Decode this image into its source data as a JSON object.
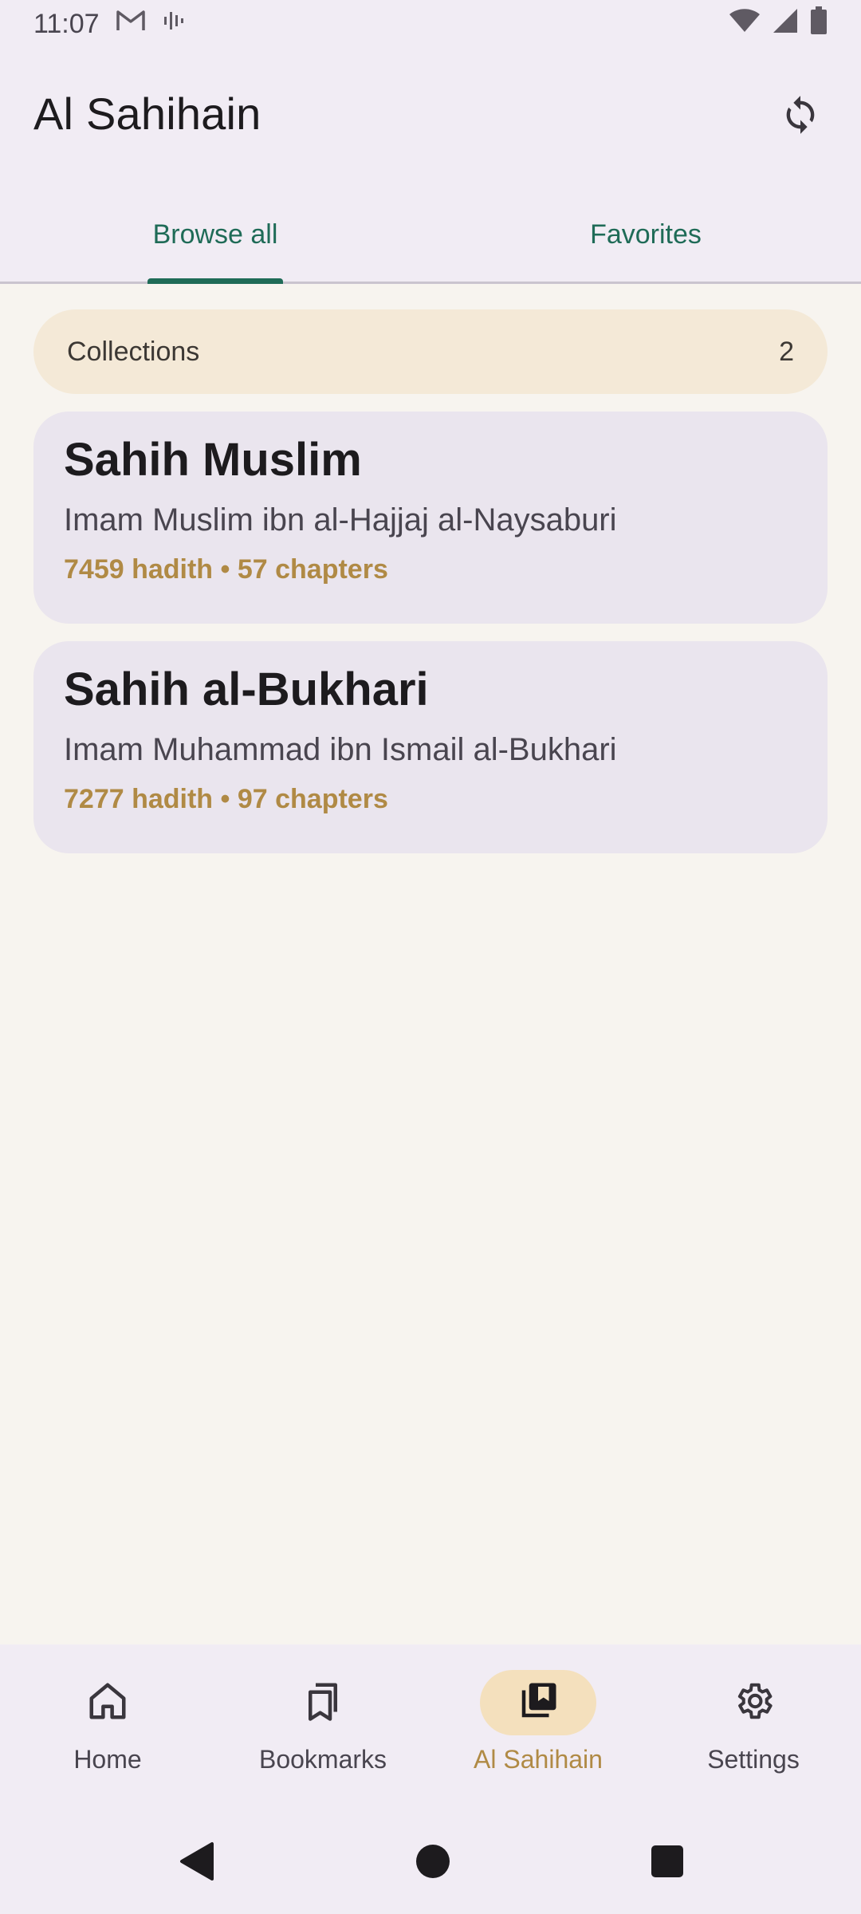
{
  "status_bar": {
    "time": "11:07",
    "icons": [
      "gmail-icon",
      "audio-icon",
      "wifi-icon",
      "signal-icon",
      "battery-icon"
    ]
  },
  "app_bar": {
    "title": "Al Sahihain",
    "action_icon": "refresh-icon"
  },
  "tabs": [
    {
      "label": "Browse all",
      "selected": true
    },
    {
      "label": "Favorites",
      "selected": false
    }
  ],
  "collections": {
    "label": "Collections",
    "count": "2"
  },
  "cards": [
    {
      "title": "Sahih Muslim",
      "author": "Imam Muslim ibn al-Hajjaj al-Naysaburi",
      "meta": "7459 hadith • 57 chapters"
    },
    {
      "title": "Sahih al-Bukhari",
      "author": "Imam Muhammad ibn Ismail al-Bukhari",
      "meta": "7277 hadith • 97 chapters"
    }
  ],
  "bottom_nav": [
    {
      "label": "Home",
      "icon": "home-icon",
      "active": false
    },
    {
      "label": "Bookmarks",
      "icon": "bookmarks-icon",
      "active": false
    },
    {
      "label": "Al Sahihain",
      "icon": "library-icon",
      "active": true
    },
    {
      "label": "Settings",
      "icon": "gear-icon",
      "active": false
    }
  ],
  "colors": {
    "accent_green": "#1f6b57",
    "accent_gold": "#b08a45",
    "surface": "#f1ecf4",
    "card": "#eae5ee",
    "collections_bg": "#f4e9d7"
  }
}
